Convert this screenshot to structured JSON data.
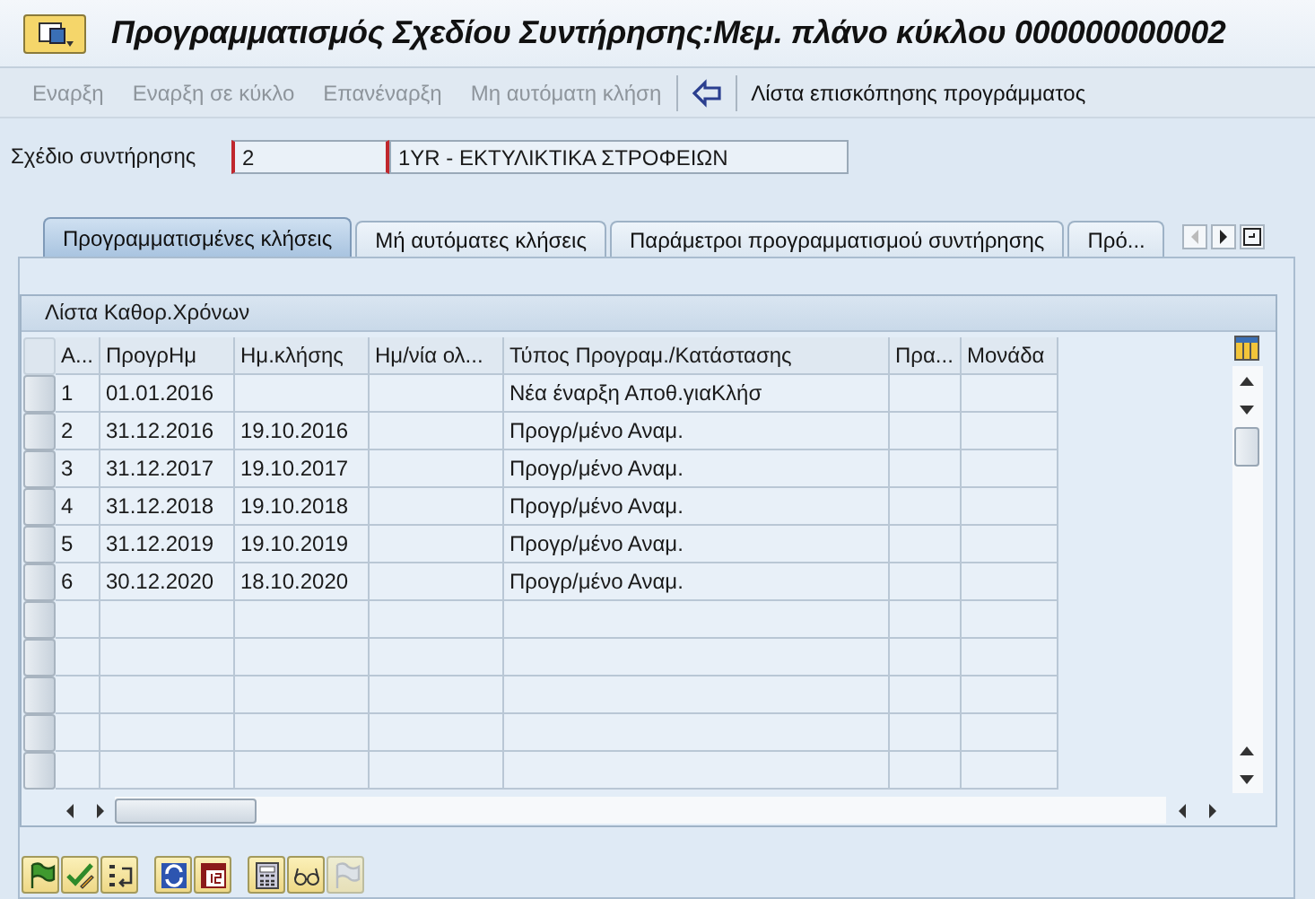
{
  "window": {
    "title": "Προγραμματισμός Σχεδίου Συντήρησης:Μεμ. πλάνο κύκλου 000000000002"
  },
  "toolbar": [
    {
      "kind": "button",
      "label": "Εναρξη",
      "disabled": true
    },
    {
      "kind": "button",
      "label": "Εναρξη σε κύκλο",
      "disabled": true
    },
    {
      "kind": "button",
      "label": "Επανέναρξη",
      "disabled": true
    },
    {
      "kind": "button",
      "label": "Μη αυτόματη κλήση",
      "disabled": true
    },
    {
      "kind": "icon",
      "disabled": false
    },
    {
      "kind": "button",
      "label": "Λίστα επισκόπησης προγράμματος",
      "disabled": false
    }
  ],
  "field": {
    "label": "Σχέδιο συντήρησης",
    "value": "2",
    "focused": true,
    "description": "1YR - ΕΚΤΥΛΙΚΤΙΚΑ ΣΤΡΟΦΕΙΩΝ"
  },
  "tabs": [
    {
      "label": "Προγραμματισμένες κλήσεις",
      "selected": true
    },
    {
      "label": "Μή αυτόματες κλήσεις",
      "selected": false
    },
    {
      "label": "Παράμετροι προγραμματισμού συντήρησης",
      "selected": false
    },
    {
      "label": "Πρό...",
      "selected": false
    }
  ],
  "table": {
    "title": "Λίστα Καθορ.Χρόνων",
    "columns": [
      "Α...",
      "ΠρογρΗμ",
      "Ημ.κλήσης",
      "Ημ/νία ολ...",
      "Τύπος Προγραμ./Κατάστασης",
      "Πρα...",
      "Μονάδα"
    ],
    "rows": [
      [
        "1",
        "01.01.2016",
        "",
        "",
        "Νέα έναρξη Αποθ.γιαΚλήσ",
        "",
        ""
      ],
      [
        "2",
        "31.12.2016",
        "19.10.2016",
        "",
        "Προγρ/μένο Αναμ.",
        "",
        ""
      ],
      [
        "3",
        "31.12.2017",
        "19.10.2017",
        "",
        "Προγρ/μένο Αναμ.",
        "",
        ""
      ],
      [
        "4",
        "31.12.2018",
        "19.10.2018",
        "",
        "Προγρ/μένο Αναμ.",
        "",
        ""
      ],
      [
        "5",
        "31.12.2019",
        "19.10.2019",
        "",
        "Προγρ/μένο Αναμ.",
        "",
        ""
      ],
      [
        "6",
        "30.12.2020",
        "18.10.2020",
        "",
        "Προγρ/μένο Αναμ.",
        "",
        ""
      ]
    ]
  },
  "bottom_toolbar": [
    [
      {
        "kind": "flag",
        "disabled": false
      },
      {
        "kind": "check",
        "disabled": false
      },
      {
        "kind": "list",
        "disabled": false
      }
    ],
    [
      {
        "kind": "refresh",
        "disabled": false
      },
      {
        "kind": "calendar",
        "disabled": false
      }
    ],
    [
      {
        "kind": "calculator",
        "disabled": false
      },
      {
        "kind": "glasses",
        "disabled": false
      },
      {
        "kind": "flag",
        "disabled": true
      }
    ]
  ]
}
